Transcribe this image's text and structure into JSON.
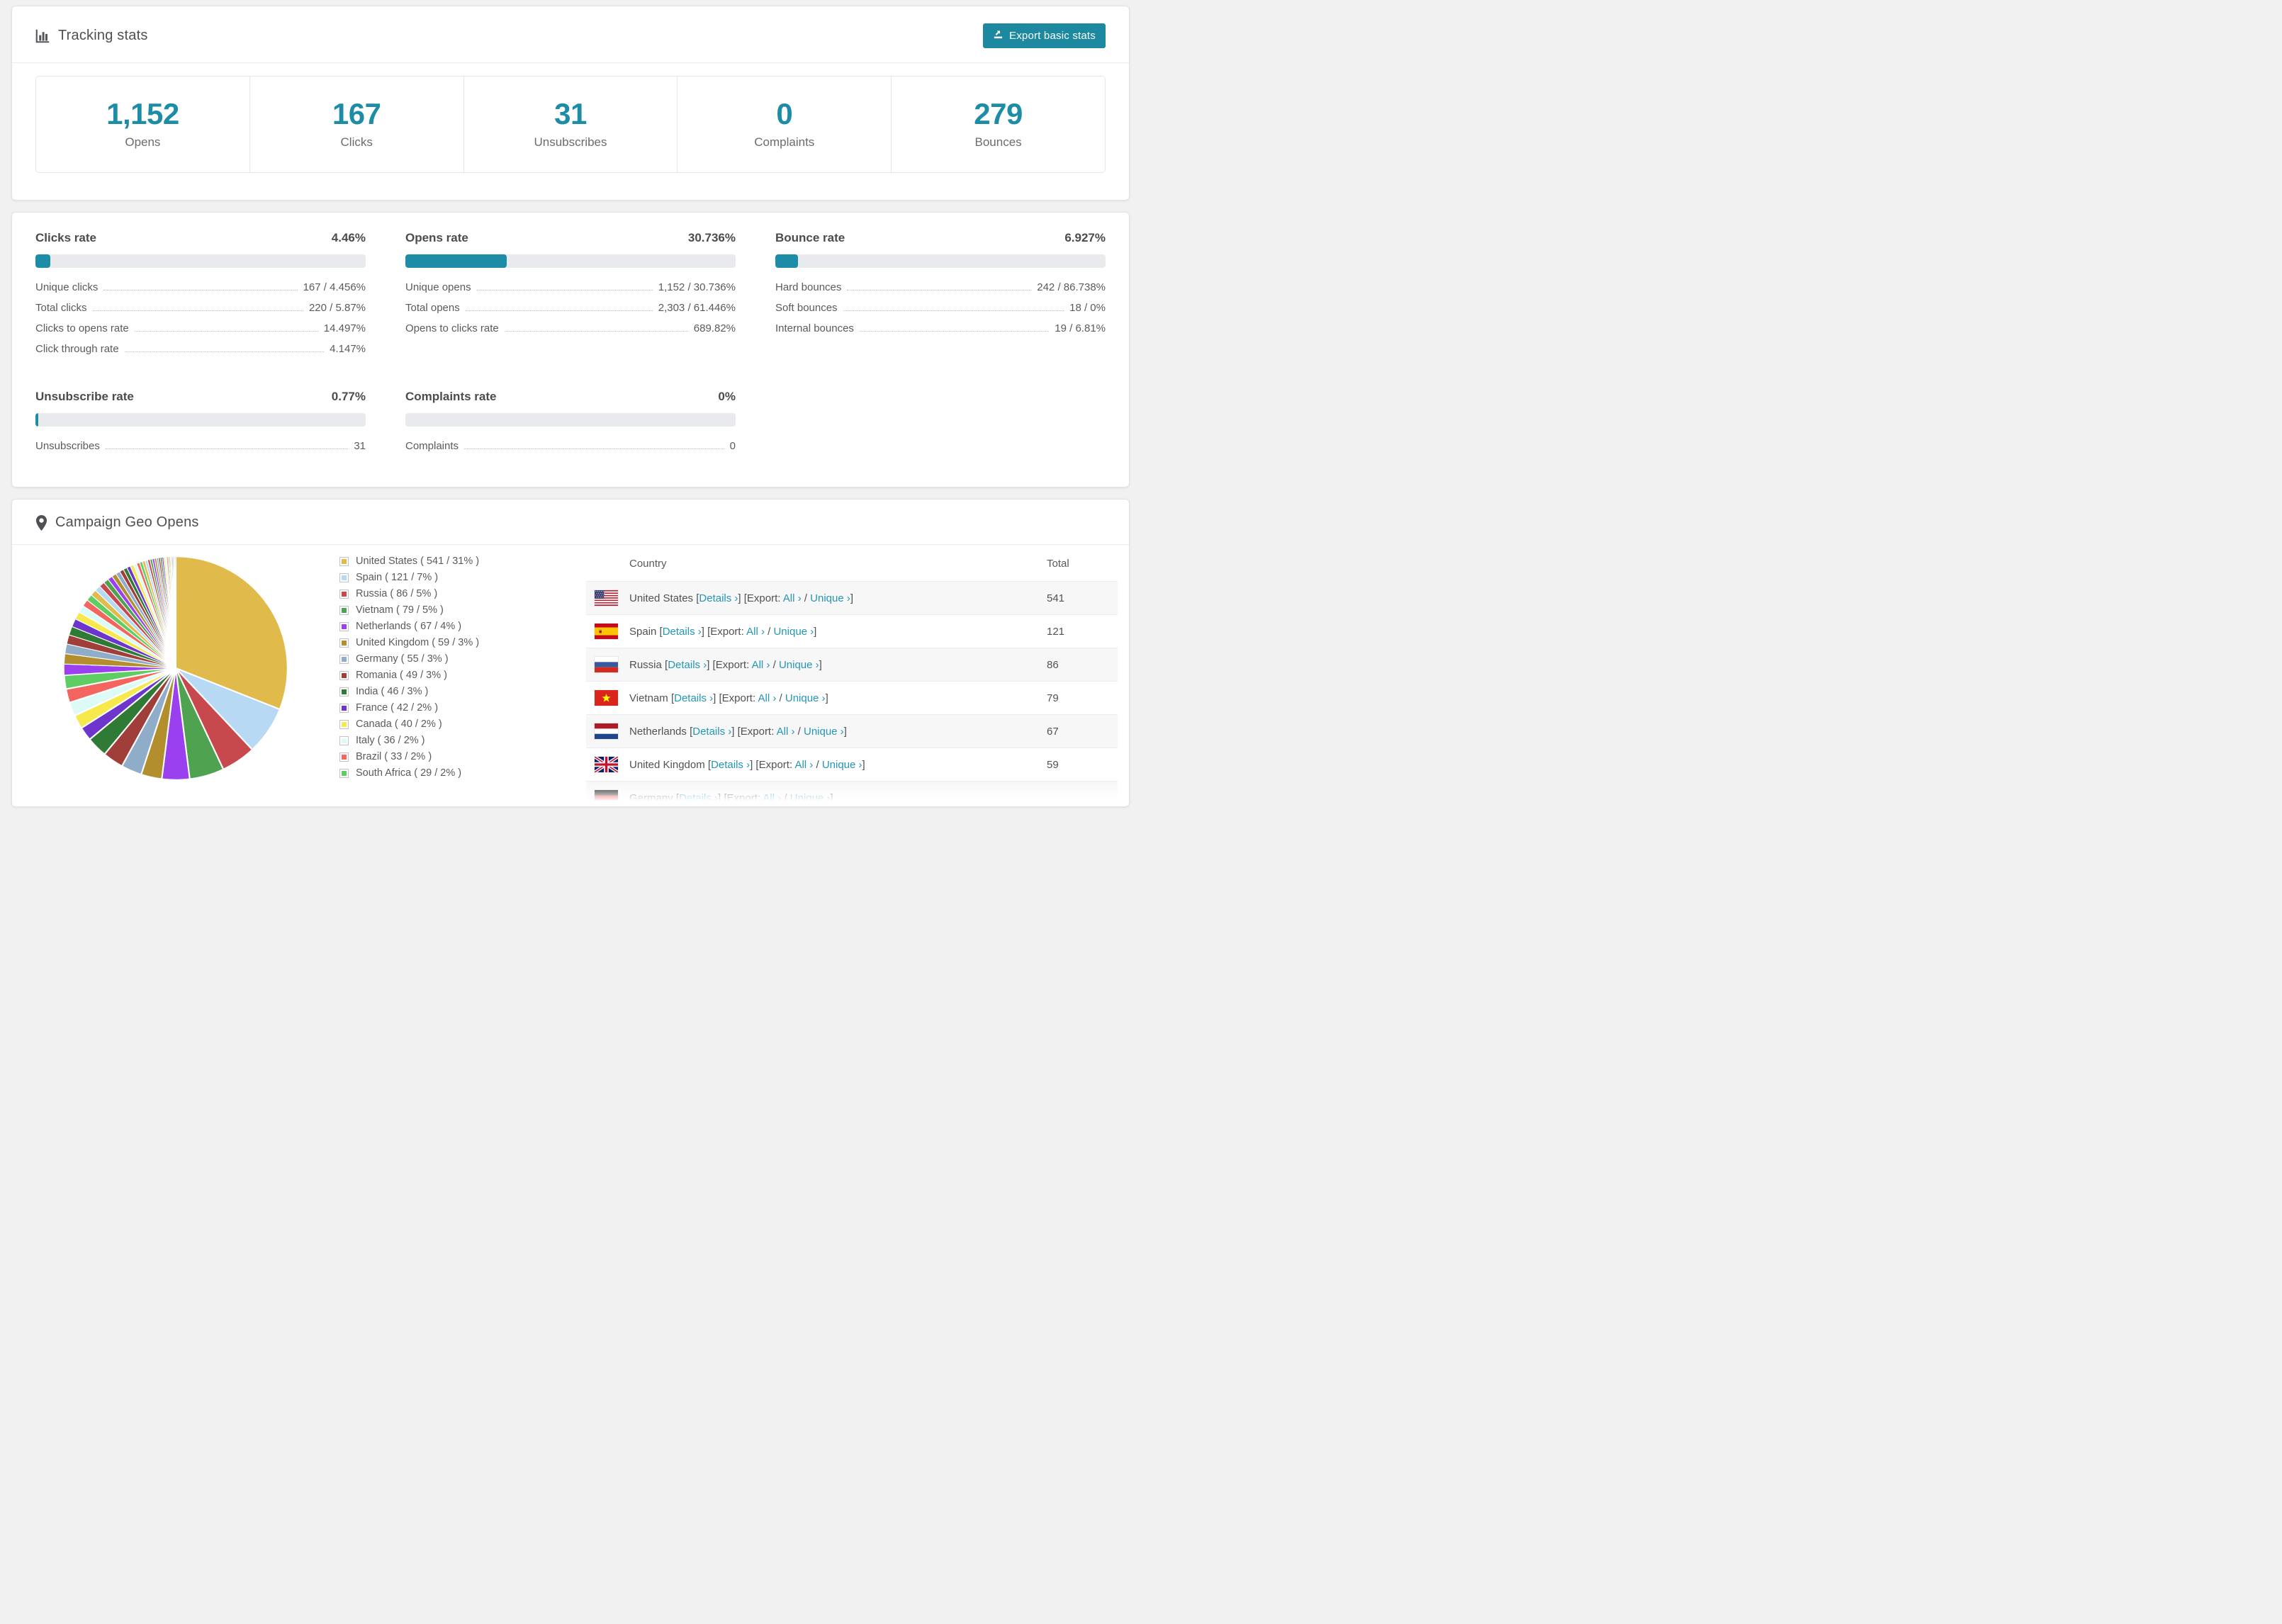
{
  "colors": {
    "accent_teal": "#1d8ca6",
    "button_teal": "#1d89a0",
    "link_teal": "#2396b6",
    "bar_track": "#e9eaee",
    "page_bg": "#f1f1f2"
  },
  "tracking_card": {
    "icon": "bar-chart-icon",
    "title": "Tracking stats",
    "export_button": "Export basic stats",
    "export_icon": "export-arrow-icon",
    "summary": [
      {
        "value": "1,152",
        "label": "Opens"
      },
      {
        "value": "167",
        "label": "Clicks"
      },
      {
        "value": "31",
        "label": "Unsubscribes"
      },
      {
        "value": "0",
        "label": "Complaints"
      },
      {
        "value": "279",
        "label": "Bounces"
      }
    ]
  },
  "rates": [
    {
      "title": "Clicks rate",
      "value": "4.46%",
      "percent": 4.46,
      "rows": [
        {
          "label": "Unique clicks",
          "value": "167 / 4.456%"
        },
        {
          "label": "Total clicks",
          "value": "220 / 5.87%"
        },
        {
          "label": "Clicks to opens rate",
          "value": "14.497%"
        },
        {
          "label": "Click through rate",
          "value": "4.147%"
        }
      ]
    },
    {
      "title": "Opens rate",
      "value": "30.736%",
      "percent": 30.736,
      "rows": [
        {
          "label": "Unique opens",
          "value": "1,152 / 30.736%"
        },
        {
          "label": "Total opens",
          "value": "2,303 / 61.446%"
        },
        {
          "label": "Opens to clicks rate",
          "value": "689.82%"
        }
      ]
    },
    {
      "title": "Bounce rate",
      "value": "6.927%",
      "percent": 6.927,
      "rows": [
        {
          "label": "Hard bounces",
          "value": "242 / 86.738%"
        },
        {
          "label": "Soft bounces",
          "value": "18 / 0%"
        },
        {
          "label": "Internal bounces",
          "value": "19 / 6.81%"
        }
      ]
    },
    {
      "title": "Unsubscribe rate",
      "value": "0.77%",
      "percent": 0.77,
      "rows": [
        {
          "label": "Unsubscribes",
          "value": "31"
        }
      ]
    },
    {
      "title": "Complaints rate",
      "value": "0%",
      "percent": 0,
      "rows": [
        {
          "label": "Complaints",
          "value": "0"
        }
      ]
    }
  ],
  "geo": {
    "icon": "map-pin-icon",
    "title": "Campaign Geo Opens",
    "chart_data": {
      "type": "pie",
      "title": "Campaign Geo Opens",
      "labels": [
        "United States",
        "Spain",
        "Russia",
        "Vietnam",
        "Netherlands",
        "United Kingdom",
        "Germany",
        "Romania",
        "India",
        "France",
        "Canada",
        "Italy",
        "Brazil",
        "South Africa"
      ],
      "values": [
        541,
        121,
        86,
        79,
        67,
        59,
        55,
        49,
        46,
        42,
        40,
        36,
        33,
        29
      ],
      "percents": [
        31,
        7,
        5,
        5,
        4,
        3,
        3,
        3,
        3,
        2,
        2,
        2,
        2,
        2
      ],
      "colors": [
        "#e0ba4b",
        "#b7d9f3",
        "#c7494e",
        "#4fa24f",
        "#9b40ee",
        "#b28f2c",
        "#8fadc8",
        "#a03f3a",
        "#2f7a35",
        "#6d35cc",
        "#f7e84b",
        "#dcfbf6",
        "#f4655f",
        "#5ecd62"
      ],
      "others_unlabeled_pct": 26,
      "start_angle_deg": 0,
      "direction": "clockwise",
      "legend_position": "right",
      "legend_format": "{label} ( {value} / {pct}% )"
    },
    "table": {
      "columns": [
        "Country",
        "Total"
      ],
      "link_labels": {
        "details": "Details ›",
        "export": "Export:",
        "all": "All ›",
        "unique": "Unique ›"
      },
      "rows": [
        {
          "country": "United States",
          "flag": "us",
          "total": "541"
        },
        {
          "country": "Spain",
          "flag": "es",
          "total": "121"
        },
        {
          "country": "Russia",
          "flag": "ru",
          "total": "86"
        },
        {
          "country": "Vietnam",
          "flag": "vn",
          "total": "79"
        },
        {
          "country": "Netherlands",
          "flag": "nl",
          "total": "67"
        },
        {
          "country": "United Kingdom",
          "flag": "gb",
          "total": "59"
        },
        {
          "country": "Germany",
          "flag": "de",
          "total": "",
          "partial": true
        }
      ]
    }
  }
}
